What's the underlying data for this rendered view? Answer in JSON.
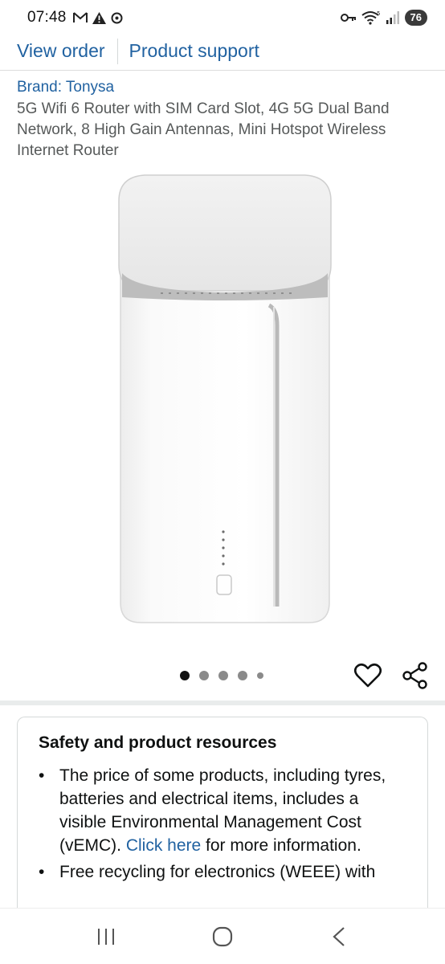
{
  "status_bar": {
    "time": "07:48",
    "left_icons": [
      "gmail-icon",
      "alert-icon",
      "vpn-icon"
    ],
    "right_icons": [
      "key-icon",
      "wifi-icon",
      "signal-icon"
    ],
    "battery": "76"
  },
  "top_links": {
    "view_order": "View order",
    "product_support": "Product support"
  },
  "product": {
    "brand": "Brand: Tonysa",
    "title": "5G Wifi 6 Router with SIM Card Slot, 4G 5G Dual Band Network, 8 High Gain Antennas, Mini Hotspot Wireless Internet Router",
    "image_icon": "router-product-image",
    "carousel": {
      "count": 5,
      "active_index": 1
    }
  },
  "actions": {
    "wishlist_icon": "heart-icon",
    "share_icon": "share-icon"
  },
  "resources": {
    "title": "Safety and product resources",
    "bullet1_text": "The price of some products, including tyres, batteries and electrical items, includes a visible Environmental Management Cost (vEMC). ",
    "bullet1_link": "Click here",
    "bullet1_suffix": " for more information.",
    "bullet2_text": "Free recycling for electronics (WEEE) with"
  },
  "nav_bar": {
    "icons": [
      "recent-apps-icon",
      "home-icon",
      "back-icon"
    ]
  },
  "colors": {
    "link": "#2162a1",
    "text": "#0f1111",
    "muted": "#565959"
  }
}
